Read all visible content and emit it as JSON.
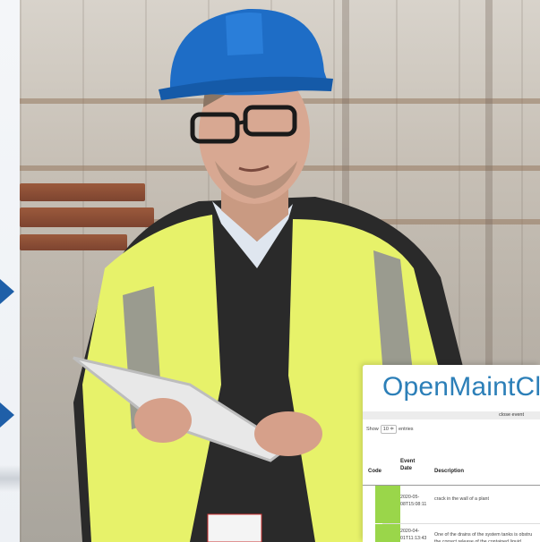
{
  "left_margin": {
    "arrow_color": "#1f5fa8"
  },
  "panel": {
    "title": "OpenMaintClos",
    "bar_label": "close event",
    "show_label": "Show",
    "show_value": "10 ≑",
    "entries_label": "entries",
    "columns": {
      "code": "Code",
      "event_date": "Event Date",
      "description": "Description"
    },
    "rows": [
      {
        "date": "2020-05-08T15:08:11",
        "description": "crack in the wall of a plant",
        "status_color": "#9ad64a"
      },
      {
        "date": "2020-04-01T11:13:43",
        "description": "One of the drains of the system tanks is obstru the correct release of the contained liquid.",
        "status_color": "#9ad64a"
      }
    ]
  }
}
